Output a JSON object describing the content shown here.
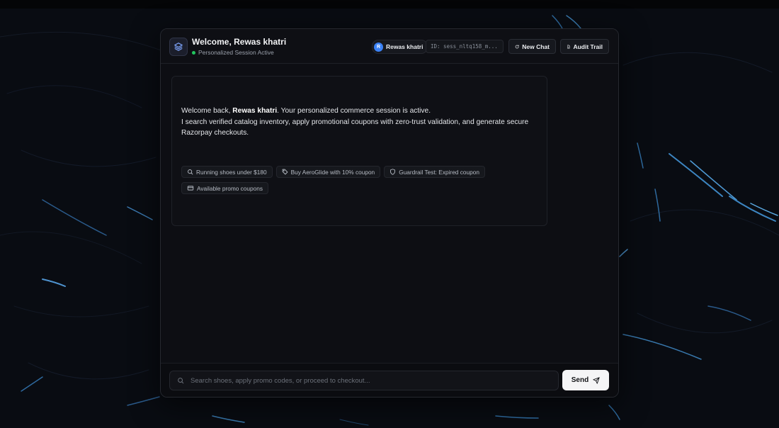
{
  "header": {
    "title": "Welcome, Rewas khatri",
    "status": "Personalized Session Active",
    "user": {
      "initial": "R",
      "name": "Rewas khatri"
    },
    "session_id": "ID: sess_nltq158_m...",
    "new_chat_label": "New Chat",
    "audit_trail_label": "Audit Trail"
  },
  "message": {
    "greeting_prefix": "Welcome back, ",
    "greeting_name": "Rewas khatri",
    "greeting_suffix": ". Your personalized commerce session is active.",
    "body": "I search verified catalog inventory, apply promotional coupons with zero-trust validation, and generate secure Razorpay checkouts."
  },
  "suggestions": [
    {
      "label": "Running shoes under $180",
      "icon": "search-icon"
    },
    {
      "label": "Buy AeroGlide with 10% coupon",
      "icon": "tag-icon"
    },
    {
      "label": "Guardrail Test: Expired coupon",
      "icon": "shield-icon"
    },
    {
      "label": "Available promo coupons",
      "icon": "credit-card-icon"
    }
  ],
  "composer": {
    "placeholder": "Search shoes, apply promo codes, or proceed to checkout...",
    "value": "",
    "send_label": "Send"
  },
  "colors": {
    "background": "#090c12",
    "panel": "#0d0e13",
    "accent": "#3b82f6",
    "status_green": "#22c55e"
  }
}
